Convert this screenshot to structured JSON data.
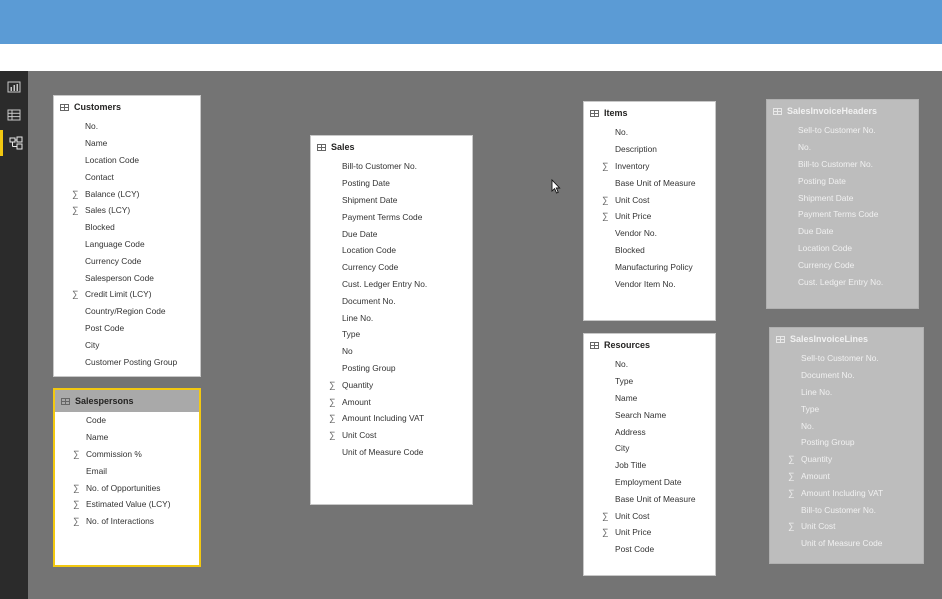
{
  "colors": {
    "topbar": "#5b9bd5",
    "canvas": "#747474",
    "leftbar": "#2b2b2b",
    "selected_border": "#f2c811"
  },
  "nav": [
    {
      "icon": "report-view-icon"
    },
    {
      "icon": "data-view-icon"
    },
    {
      "icon": "relationships-view-icon",
      "active": true
    }
  ],
  "tables": {
    "customers": {
      "title": "Customers",
      "fields": [
        {
          "name": "No.",
          "sum": false
        },
        {
          "name": "Name",
          "sum": false
        },
        {
          "name": "Location Code",
          "sum": false
        },
        {
          "name": "Contact",
          "sum": false
        },
        {
          "name": "Balance (LCY)",
          "sum": true
        },
        {
          "name": "Sales (LCY)",
          "sum": true
        },
        {
          "name": "Blocked",
          "sum": false
        },
        {
          "name": "Language Code",
          "sum": false
        },
        {
          "name": "Currency Code",
          "sum": false
        },
        {
          "name": "Salesperson Code",
          "sum": false
        },
        {
          "name": "Credit Limit (LCY)",
          "sum": true
        },
        {
          "name": "Country/Region Code",
          "sum": false
        },
        {
          "name": "Post Code",
          "sum": false
        },
        {
          "name": "City",
          "sum": false
        },
        {
          "name": "Customer Posting Group",
          "sum": false
        }
      ]
    },
    "salespersons": {
      "title": "Salespersons",
      "fields": [
        {
          "name": "Code",
          "sum": false
        },
        {
          "name": "Name",
          "sum": false
        },
        {
          "name": "Commission %",
          "sum": true
        },
        {
          "name": "Email",
          "sum": false
        },
        {
          "name": "No. of Opportunities",
          "sum": true
        },
        {
          "name": "Estimated Value (LCY)",
          "sum": true
        },
        {
          "name": "No. of Interactions",
          "sum": true
        }
      ]
    },
    "sales": {
      "title": "Sales",
      "fields": [
        {
          "name": "Bill-to Customer No.",
          "sum": false
        },
        {
          "name": "Posting Date",
          "sum": false
        },
        {
          "name": "Shipment Date",
          "sum": false
        },
        {
          "name": "Payment Terms Code",
          "sum": false
        },
        {
          "name": "Due Date",
          "sum": false
        },
        {
          "name": "Location Code",
          "sum": false
        },
        {
          "name": "Currency Code",
          "sum": false
        },
        {
          "name": "Cust. Ledger Entry No.",
          "sum": false
        },
        {
          "name": "Document No.",
          "sum": false
        },
        {
          "name": "Line No.",
          "sum": false
        },
        {
          "name": "Type",
          "sum": false
        },
        {
          "name": "No",
          "sum": false
        },
        {
          "name": "Posting Group",
          "sum": false
        },
        {
          "name": "Quantity",
          "sum": true
        },
        {
          "name": "Amount",
          "sum": true
        },
        {
          "name": "Amount Including VAT",
          "sum": true
        },
        {
          "name": "Unit Cost",
          "sum": true
        },
        {
          "name": "Unit of Measure Code",
          "sum": false
        }
      ]
    },
    "items": {
      "title": "Items",
      "fields": [
        {
          "name": "No.",
          "sum": false
        },
        {
          "name": "Description",
          "sum": false
        },
        {
          "name": "Inventory",
          "sum": true
        },
        {
          "name": "Base Unit of Measure",
          "sum": false
        },
        {
          "name": "Unit Cost",
          "sum": true
        },
        {
          "name": "Unit Price",
          "sum": true
        },
        {
          "name": "Vendor No.",
          "sum": false
        },
        {
          "name": "Blocked",
          "sum": false
        },
        {
          "name": "Manufacturing Policy",
          "sum": false
        },
        {
          "name": "Vendor Item No.",
          "sum": false
        }
      ]
    },
    "resources": {
      "title": "Resources",
      "fields": [
        {
          "name": "No.",
          "sum": false
        },
        {
          "name": "Type",
          "sum": false
        },
        {
          "name": "Name",
          "sum": false
        },
        {
          "name": "Search Name",
          "sum": false
        },
        {
          "name": "Address",
          "sum": false
        },
        {
          "name": "City",
          "sum": false
        },
        {
          "name": "Job Title",
          "sum": false
        },
        {
          "name": "Employment Date",
          "sum": false
        },
        {
          "name": "Base Unit of Measure",
          "sum": false
        },
        {
          "name": "Unit Cost",
          "sum": true
        },
        {
          "name": "Unit Price",
          "sum": true
        },
        {
          "name": "Post Code",
          "sum": false
        }
      ]
    },
    "sales_invoice_headers": {
      "title": "SalesInvoiceHeaders",
      "fields": [
        {
          "name": "Sell-to Customer No.",
          "sum": false
        },
        {
          "name": "No.",
          "sum": false
        },
        {
          "name": "Bill-to Customer No.",
          "sum": false
        },
        {
          "name": "Posting Date",
          "sum": false
        },
        {
          "name": "Shipment Date",
          "sum": false
        },
        {
          "name": "Payment Terms Code",
          "sum": false
        },
        {
          "name": "Due Date",
          "sum": false
        },
        {
          "name": "Location Code",
          "sum": false
        },
        {
          "name": "Currency Code",
          "sum": false
        },
        {
          "name": "Cust. Ledger Entry No.",
          "sum": false
        }
      ]
    },
    "sales_invoice_lines": {
      "title": "SalesInvoiceLines",
      "fields": [
        {
          "name": "Sell-to Customer No.",
          "sum": false
        },
        {
          "name": "Document No.",
          "sum": false
        },
        {
          "name": "Line No.",
          "sum": false
        },
        {
          "name": "Type",
          "sum": false
        },
        {
          "name": "No.",
          "sum": false
        },
        {
          "name": "Posting Group",
          "sum": false
        },
        {
          "name": "Quantity",
          "sum": true
        },
        {
          "name": "Amount",
          "sum": true
        },
        {
          "name": "Amount Including VAT",
          "sum": true
        },
        {
          "name": "Bill-to Customer No.",
          "sum": false
        },
        {
          "name": "Unit Cost",
          "sum": true
        },
        {
          "name": "Unit of Measure Code",
          "sum": false
        }
      ]
    }
  }
}
